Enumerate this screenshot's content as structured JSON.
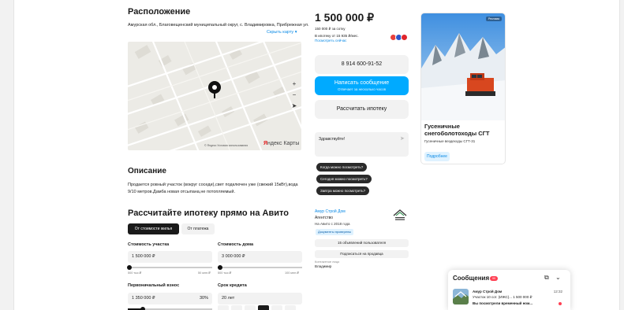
{
  "location": {
    "title": "Расположение",
    "address": "Амурская обл., Благовещенский муниципальный округ, с. Владимировка, Прибрежная ул.",
    "hide_map": "Скрыть карту",
    "map_attribution": "© Яндекс Условия использования",
    "map_logo_ya": "Я",
    "map_logo_rest": "ндекс Карты",
    "zoom_in": "+",
    "zoom_out": "−"
  },
  "description": {
    "title": "Описание",
    "text": "Продается ровный участок (вокруг соседи),свет подключен уже (свежий 15кВт),вода 9/10 метров.Дамба новая отсыпана,не потопляемый."
  },
  "mortgage": {
    "title": "Рассчитайте ипотеку прямо на Авито",
    "tab_active": "От стоимости жилья",
    "tab_inactive": "От платежа",
    "plot_cost_label": "Стоимость участка",
    "plot_cost_value": "1 500 000 ₽",
    "plot_range_min": "500 тыс.₽",
    "plot_range_max": "50 млн.₽",
    "plot_fraction": 0.02,
    "house_cost_label": "Стоимость дома",
    "house_cost_value": "3 000 000 ₽",
    "house_range_min": "500 тыс.₽",
    "house_range_max": "100 млн.₽",
    "house_fraction": 0.03,
    "down_payment_label": "Первоначальный взнос",
    "down_payment_value": "1 350 000 ₽",
    "down_payment_percent": "30%",
    "term_label": "Срок кредита",
    "term_value": "20 лет"
  },
  "price": {
    "value": "1 500 000 ₽",
    "per_sotka": "150 000 ₽ за сотку",
    "ipoteka": "В ипотеку от 15 935 ₽/мес.",
    "offers": "Посмотреть сейчас"
  },
  "actions": {
    "phone": "8 914 600-91-52",
    "write": "Написать сообщение",
    "write_sub": "Отвечает за несколько часов",
    "calc": "Рассчитать ипотеку"
  },
  "chat": {
    "input_value": "Здравствуйте!",
    "quick_replies": [
      "Когда можно посмотреть?",
      "Сегодня можно посмотреть?",
      "Завтра можно посмотреть?"
    ]
  },
  "seller": {
    "name": "Амур Строй Дом",
    "type": "Агентство",
    "since": "На Авито с 2018 года",
    "badge": "Документы проверены",
    "listings_btn": "15 объявлений пользователя",
    "subscribe_btn": "Подписаться на продавца",
    "contact_label": "Контактное лицо",
    "contact_name": "Владимир"
  },
  "ad": {
    "tag": "Реклама",
    "title": "Гусеничные снегоболотоходы СГТ",
    "subtitle": "Гусеничные вездеходы СГТ-31",
    "more": "Подробнее"
  },
  "messages": {
    "title": "Сообщения",
    "badge": "99",
    "item_name": "Амур Строй Дом",
    "item_line1": "Участок 10 сот. (ИЖС)... 1 500 000 ₽",
    "item_line2": "Вы посмотрели временный ном...",
    "item_time": "12:32"
  },
  "colors": {
    "accent": "#00aaff",
    "link": "#0a8ae6",
    "badge": "#ff4053",
    "dark": "#1a1a1a"
  }
}
